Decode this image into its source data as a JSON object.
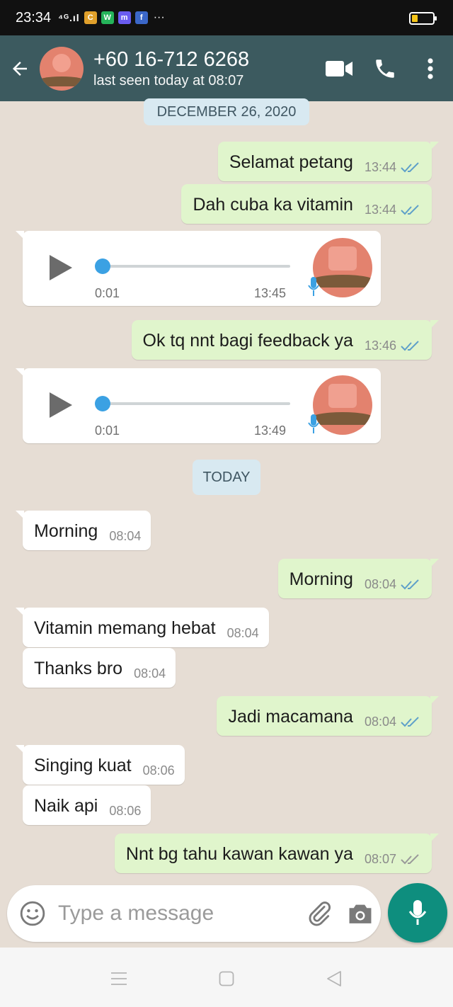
{
  "status_bar": {
    "time": "23:34",
    "signal": "⁴ᴳ.ıl",
    "apps": [
      {
        "name": "chrome-icon",
        "letter": "C",
        "color": "#e0a02b"
      },
      {
        "name": "whatsapp-icon",
        "letter": "W",
        "color": "#25b45a"
      },
      {
        "name": "messenger-icon",
        "letter": "m",
        "color": "#6a5cf0"
      },
      {
        "name": "facebook-icon",
        "letter": "f",
        "color": "#3b67c8"
      }
    ],
    "more": "···"
  },
  "header": {
    "contact_name": "+60 16-712 6268",
    "last_seen": "last seen today at 08:07"
  },
  "colors": {
    "header_bg": "#3c5a5f",
    "chat_bg": "#e6ddd4",
    "outgoing_bubble": "#e0f5cc",
    "incoming_bubble": "#ffffff",
    "tick_color": "#5fa0c9",
    "accent": "#0e8e7e"
  },
  "date_dividers": {
    "first": "DECEMBER 26, 2020",
    "second": "TODAY"
  },
  "messages": [
    {
      "direction": "out",
      "text": "Selamat petang",
      "time": "13:44",
      "status": "read"
    },
    {
      "direction": "out",
      "text": "Dah cuba ka vitamin",
      "time": "13:44",
      "status": "read"
    },
    {
      "direction": "in",
      "type": "voice",
      "duration": "0:01",
      "time": "13:45",
      "progress": 0
    },
    {
      "direction": "out",
      "text": "Ok tq nnt bagi feedback ya",
      "time": "13:46",
      "status": "read"
    },
    {
      "direction": "in",
      "type": "voice",
      "duration": "0:01",
      "time": "13:49",
      "progress": 0
    },
    {
      "direction": "in",
      "text": "Morning",
      "time": "08:04"
    },
    {
      "direction": "out",
      "text": "Morning",
      "time": "08:04",
      "status": "read"
    },
    {
      "direction": "in",
      "text": "Vitamin memang hebat",
      "time": "08:04"
    },
    {
      "direction": "in",
      "text": "Thanks bro",
      "time": "08:04"
    },
    {
      "direction": "out",
      "text": "Jadi macamana",
      "time": "08:04",
      "status": "read"
    },
    {
      "direction": "in",
      "text": "Singing kuat",
      "time": "08:06"
    },
    {
      "direction": "in",
      "text": "Naik api",
      "time": "08:06"
    },
    {
      "direction": "out",
      "text": "Nnt bg tahu kawan kawan ya",
      "time": "08:07",
      "status": "delivered"
    }
  ],
  "composer": {
    "placeholder": "Type a message"
  }
}
